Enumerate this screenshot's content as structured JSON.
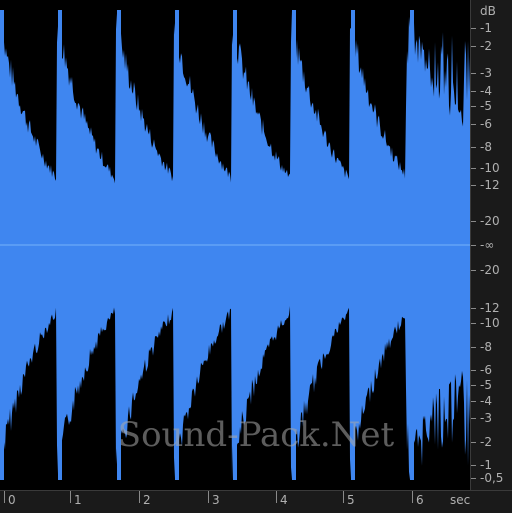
{
  "db_scale": {
    "unit": "dB",
    "upper_labels": [
      "-1",
      "-2",
      "-3",
      "-4",
      "-5",
      "-6",
      "-8",
      "-10",
      "-12",
      "-20"
    ],
    "center_label": "-∞",
    "lower_labels": [
      "-20",
      "-12",
      "-10",
      "-8",
      "-6",
      "-5",
      "-4",
      "-3",
      "-2",
      "-1",
      "-0,5"
    ]
  },
  "time_scale": {
    "unit": "sec",
    "labels": [
      "0",
      "1",
      "2",
      "3",
      "4",
      "5",
      "6"
    ]
  },
  "watermark": "Sound-Pack.Net",
  "colors": {
    "waveform": "#3f86f0",
    "background": "#000000",
    "scale_text": "#b0b0b0"
  }
}
